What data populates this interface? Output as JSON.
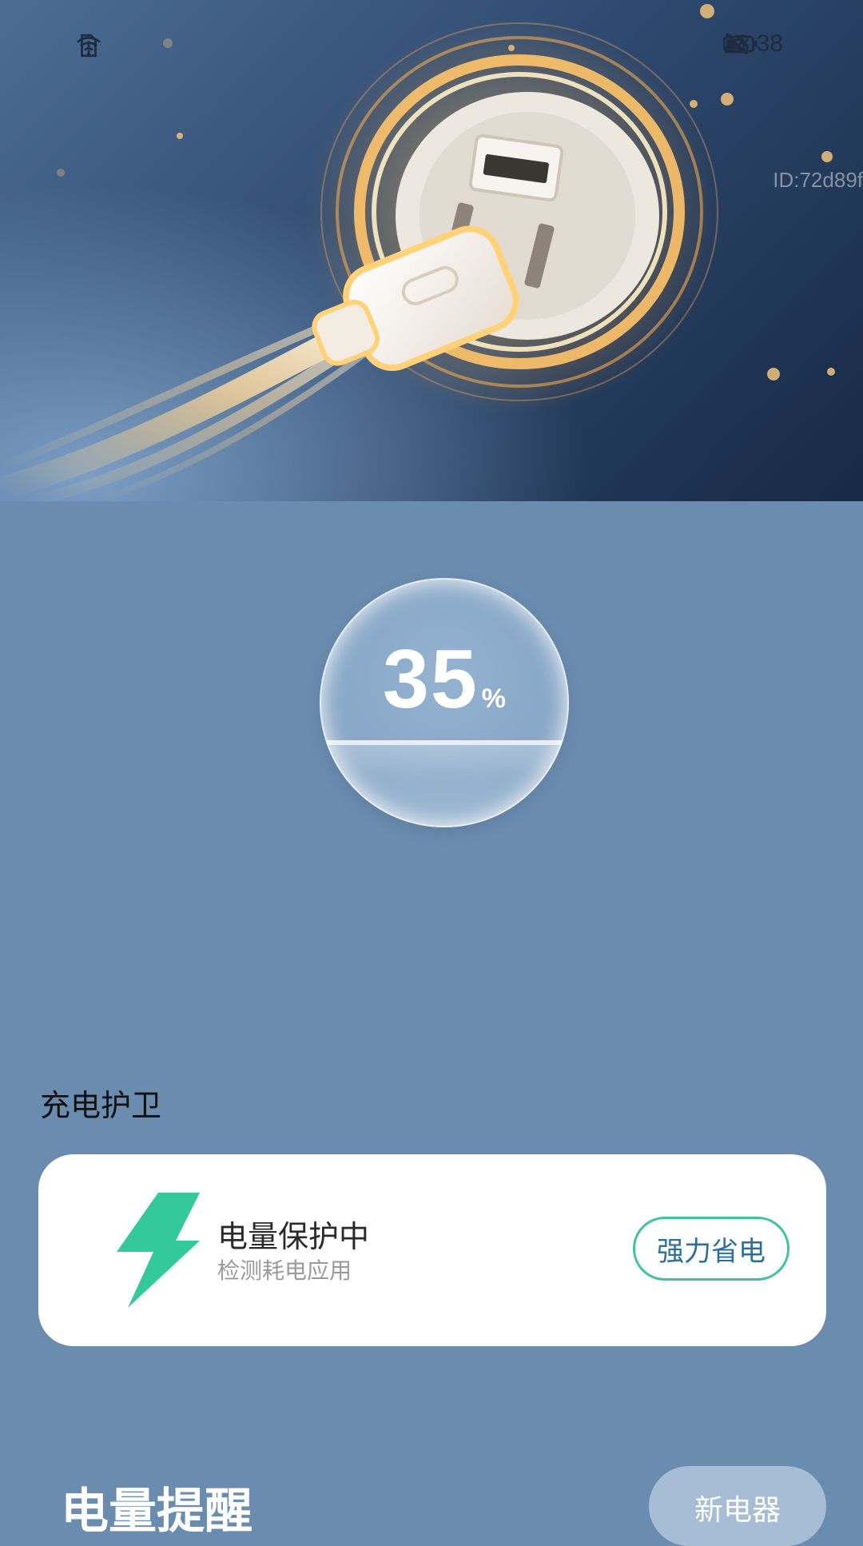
{
  "status_bar": {
    "time": "13:38",
    "icons": [
      "sim-alert-icon",
      "wifi-icon",
      "bell-off-icon",
      "speed-icon",
      "battery-icon"
    ]
  },
  "hero": {
    "watermark_id": "ID:72d89f",
    "image": "charger-plug-glow-illustration"
  },
  "battery": {
    "value": "35",
    "unit": "%",
    "level_fraction": 0.35
  },
  "guard": {
    "section_title": "充电护卫",
    "icon": "lightning-bolt-icon",
    "title": "电量保护中",
    "subtitle": "检测耗电应用",
    "action_label": "强力省电",
    "accent_color": "#3cc49e"
  },
  "reminder": {
    "section_title": "电量提醒",
    "action_label": "新电器"
  },
  "colors": {
    "page_bg": "#6a8caf",
    "card_bg": "#ffffff",
    "bolt": "#34c99a",
    "button_text": "#2a6f9e"
  }
}
